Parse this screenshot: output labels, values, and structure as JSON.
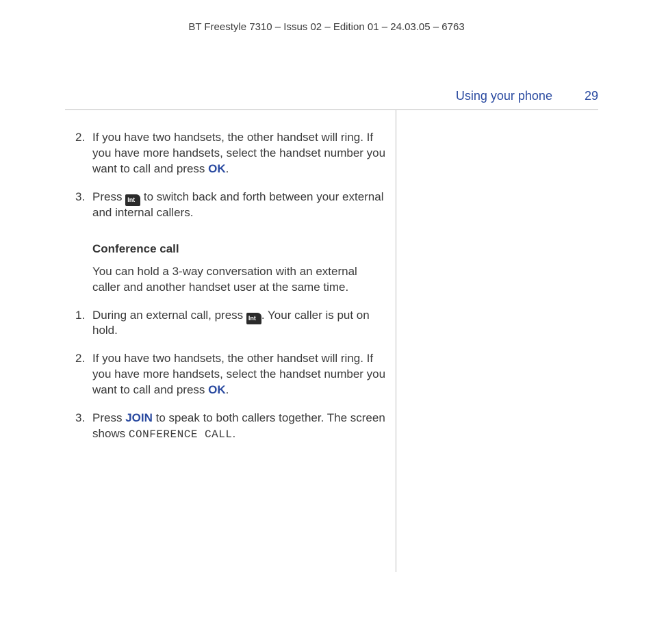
{
  "doc_header": "BT Freestyle 7310 – Issus 02 – Edition 01 – 24.03.05 – 6763",
  "running_head": {
    "section": "Using your phone",
    "page": "29"
  },
  "int_key_label": "Int",
  "section1": {
    "step2_num": "2.",
    "step2_a": "If you have two handsets, the other handset will ring. If you have more handsets, select the handset number you want to call and press ",
    "step2_ok": "OK",
    "step2_b": ".",
    "step3_num": "3.",
    "step3_a": "Press ",
    "step3_b": " to switch back and forth between your external and internal callers."
  },
  "conf": {
    "heading": "Conference call",
    "intro": "You can hold a 3-way conversation with an external caller and another handset user at the same time.",
    "step1_num": "1.",
    "step1_a": "During an external call, press ",
    "step1_b": ". Your caller is put on hold.",
    "step2_num": "2.",
    "step2_a": "If you have two handsets, the other handset will ring. If you have more handsets, select the handset number you want to call and press ",
    "step2_ok": "OK",
    "step2_b": ".",
    "step3_num": "3.",
    "step3_a": "Press ",
    "step3_join": "JOIN",
    "step3_b": " to speak to both callers together. The screen shows ",
    "step3_screen": "CONFERENCE CALL",
    "step3_c": "."
  }
}
